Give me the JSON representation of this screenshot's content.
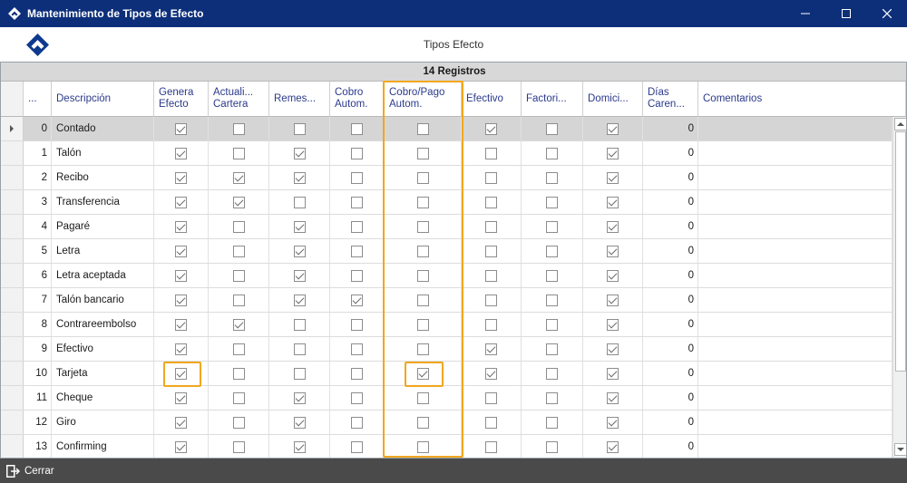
{
  "window": {
    "title": "Mantenimiento de Tipos de Efecto"
  },
  "header": {
    "subtitle": "Tipos Efecto"
  },
  "grid": {
    "records_label": "14 Registros",
    "columns": {
      "num": "...",
      "descripcion": "Descripción",
      "genera": "Genera\nEfecto",
      "actualiza": "Actuali...\nCartera",
      "remesa": "Remes...",
      "cobro": "Cobro\nAutom.",
      "cobropago": "Cobro/Pago\nAutom.",
      "efectivo": "Efectivo",
      "factoring": "Factori...",
      "domicilia": "Domici...",
      "dias": "Días\nCaren...",
      "comentarios": "Comentarios"
    },
    "rows": [
      {
        "num": "0",
        "desc": "Contado",
        "genera": true,
        "actualiza": false,
        "remesa": false,
        "cobro": false,
        "cobropago": false,
        "efectivo": true,
        "factoring": false,
        "domicilia": true,
        "dias": "0",
        "comentarios": ""
      },
      {
        "num": "1",
        "desc": "Talón",
        "genera": true,
        "actualiza": false,
        "remesa": true,
        "cobro": false,
        "cobropago": false,
        "efectivo": false,
        "factoring": false,
        "domicilia": true,
        "dias": "0",
        "comentarios": ""
      },
      {
        "num": "2",
        "desc": "Recibo",
        "genera": true,
        "actualiza": true,
        "remesa": true,
        "cobro": false,
        "cobropago": false,
        "efectivo": false,
        "factoring": false,
        "domicilia": true,
        "dias": "0",
        "comentarios": ""
      },
      {
        "num": "3",
        "desc": "Transferencia",
        "genera": true,
        "actualiza": true,
        "remesa": false,
        "cobro": false,
        "cobropago": false,
        "efectivo": false,
        "factoring": false,
        "domicilia": true,
        "dias": "0",
        "comentarios": ""
      },
      {
        "num": "4",
        "desc": "Pagaré",
        "genera": true,
        "actualiza": false,
        "remesa": true,
        "cobro": false,
        "cobropago": false,
        "efectivo": false,
        "factoring": false,
        "domicilia": true,
        "dias": "0",
        "comentarios": ""
      },
      {
        "num": "5",
        "desc": "Letra",
        "genera": true,
        "actualiza": false,
        "remesa": true,
        "cobro": false,
        "cobropago": false,
        "efectivo": false,
        "factoring": false,
        "domicilia": true,
        "dias": "0",
        "comentarios": ""
      },
      {
        "num": "6",
        "desc": "Letra aceptada",
        "genera": true,
        "actualiza": false,
        "remesa": true,
        "cobro": false,
        "cobropago": false,
        "efectivo": false,
        "factoring": false,
        "domicilia": true,
        "dias": "0",
        "comentarios": ""
      },
      {
        "num": "7",
        "desc": "Talón bancario",
        "genera": true,
        "actualiza": false,
        "remesa": true,
        "cobro": true,
        "cobropago": false,
        "efectivo": false,
        "factoring": false,
        "domicilia": true,
        "dias": "0",
        "comentarios": ""
      },
      {
        "num": "8",
        "desc": "Contrareembolso",
        "genera": true,
        "actualiza": true,
        "remesa": false,
        "cobro": false,
        "cobropago": false,
        "efectivo": false,
        "factoring": false,
        "domicilia": true,
        "dias": "0",
        "comentarios": ""
      },
      {
        "num": "9",
        "desc": "Efectivo",
        "genera": true,
        "actualiza": false,
        "remesa": false,
        "cobro": false,
        "cobropago": false,
        "efectivo": true,
        "factoring": false,
        "domicilia": true,
        "dias": "0",
        "comentarios": ""
      },
      {
        "num": "10",
        "desc": "Tarjeta",
        "genera": true,
        "actualiza": false,
        "remesa": false,
        "cobro": false,
        "cobropago": true,
        "efectivo": true,
        "factoring": false,
        "domicilia": true,
        "dias": "0",
        "comentarios": ""
      },
      {
        "num": "11",
        "desc": "Cheque",
        "genera": true,
        "actualiza": false,
        "remesa": true,
        "cobro": false,
        "cobropago": false,
        "efectivo": false,
        "factoring": false,
        "domicilia": true,
        "dias": "0",
        "comentarios": ""
      },
      {
        "num": "12",
        "desc": "Giro",
        "genera": true,
        "actualiza": false,
        "remesa": true,
        "cobro": false,
        "cobropago": false,
        "efectivo": false,
        "factoring": false,
        "domicilia": true,
        "dias": "0",
        "comentarios": ""
      },
      {
        "num": "13",
        "desc": "Confirming",
        "genera": true,
        "actualiza": false,
        "remesa": true,
        "cobro": false,
        "cobropago": false,
        "efectivo": false,
        "factoring": false,
        "domicilia": true,
        "dias": "0",
        "comentarios": ""
      }
    ]
  },
  "footer": {
    "close_label": "Cerrar"
  },
  "colors": {
    "titlebar": "#0d2f7a",
    "header_text": "#2b3a8c",
    "highlight": "#f0a81e",
    "footer": "#4a4a4a"
  },
  "icons": {
    "app": "app-logo-icon",
    "minimize": "minimize-icon",
    "maximize": "maximize-icon",
    "close": "close-icon",
    "exit": "exit-icon"
  }
}
